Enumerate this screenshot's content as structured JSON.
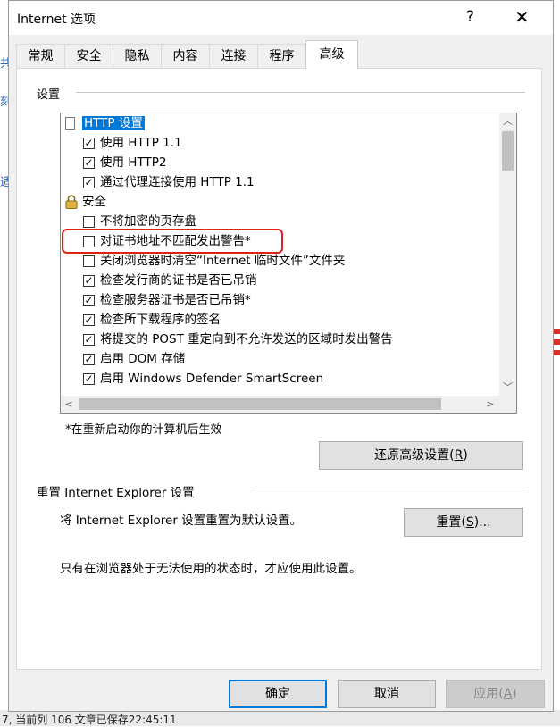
{
  "window": {
    "title": "Internet 选项",
    "help_glyph": "?",
    "close_glyph": "✕"
  },
  "tabs": [
    {
      "label": "常规",
      "active": false
    },
    {
      "label": "安全",
      "active": false
    },
    {
      "label": "隐私",
      "active": false
    },
    {
      "label": "内容",
      "active": false
    },
    {
      "label": "连接",
      "active": false
    },
    {
      "label": "程序",
      "active": false
    },
    {
      "label": "高级",
      "active": true
    }
  ],
  "settings_group": {
    "label": "设置"
  },
  "settings_list": [
    {
      "text": "HTTP 设置",
      "kind": "category",
      "icon": "page-icon",
      "selected": true
    },
    {
      "text": "使用 HTTP 1.1",
      "kind": "checkbox",
      "checked": true
    },
    {
      "text": "使用 HTTP2",
      "kind": "checkbox",
      "checked": true
    },
    {
      "text": "通过代理连接使用 HTTP 1.1",
      "kind": "checkbox",
      "checked": true
    },
    {
      "text": "安全",
      "kind": "category",
      "icon": "lock-icon"
    },
    {
      "text": "不将加密的页存盘",
      "kind": "checkbox",
      "checked": false
    },
    {
      "text": "对证书地址不匹配发出警告*",
      "kind": "checkbox",
      "checked": false,
      "highlighted": true
    },
    {
      "text": "关闭浏览器时清空“Internet 临时文件”文件夹",
      "kind": "checkbox",
      "checked": false
    },
    {
      "text": "检查发行商的证书是否已吊销",
      "kind": "checkbox",
      "checked": true
    },
    {
      "text": "检查服务器证书是否已吊销*",
      "kind": "checkbox",
      "checked": true
    },
    {
      "text": "检查所下载程序的签名",
      "kind": "checkbox",
      "checked": true
    },
    {
      "text": "将提交的 POST 重定向到不允许发送的区域时发出警告",
      "kind": "checkbox",
      "checked": true
    },
    {
      "text": "启用 DOM 存储",
      "kind": "checkbox",
      "checked": true
    },
    {
      "text": "启用 Windows Defender SmartScreen",
      "kind": "checkbox",
      "checked": true
    }
  ],
  "restart_note": "*在重新启动你的计算机后生效",
  "restore_button": {
    "label": "还原高级设置(",
    "mnemonic": "R",
    "suffix": ")"
  },
  "reset_group": {
    "label": "重置 Internet Explorer 设置",
    "description": "将 Internet Explorer 设置重置为默认设置。",
    "button": {
      "label": "重置(",
      "mnemonic": "S",
      "suffix": ")..."
    },
    "warning": "只有在浏览器处于无法使用的状态时，才应使用此设置。"
  },
  "footer": {
    "ok": "确定",
    "cancel": "取消",
    "apply": {
      "label": "应用(",
      "mnemonic": "A",
      "suffix": ")"
    }
  },
  "background": {
    "left_fragments": [
      "共",
      "刻",
      "适"
    ],
    "status_text": "7, 当前列 106   文章已保存22:45:11"
  },
  "colors": {
    "selection": "#0078d7",
    "highlight_box": "#e0201b",
    "default_button_border": "#0078d7"
  }
}
